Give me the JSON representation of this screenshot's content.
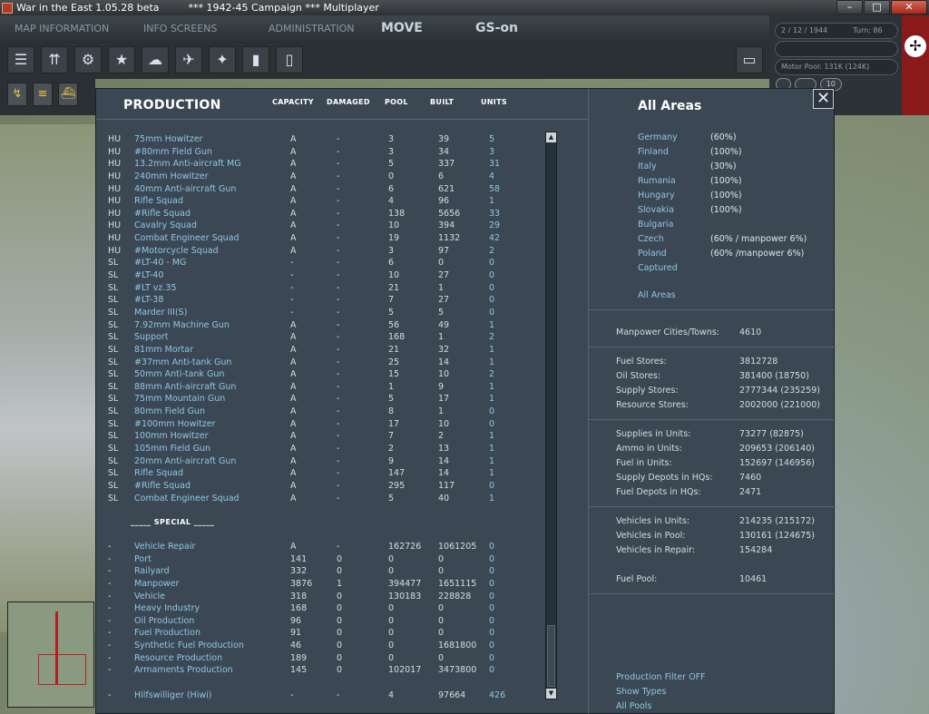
{
  "window": {
    "title": "War in the East 1.05.28 beta",
    "campaign": "***   1942-45 Campaign   ***   Multiplayer"
  },
  "nav": {
    "tabs": [
      "MAP INFORMATION",
      "INFO SCREENS",
      "ADMINISTRATION"
    ],
    "move": "MOVE",
    "gs": "GS-on"
  },
  "status": {
    "date": "2 / 12 / 1944",
    "turn": "Turn: 86",
    "motor_pool": "Motor Pool: 131K (124K)",
    "zoom_value": "10"
  },
  "production": {
    "title": "PRODUCTION",
    "columns": {
      "capacity": "CAPACITY",
      "damaged": "DAMAGED",
      "pool": "POOL",
      "built": "BUILT",
      "units": "UNITS"
    },
    "rows": [
      [
        "HU",
        "75mm Howitzer",
        "A",
        "-",
        "3",
        "39",
        "5"
      ],
      [
        "HU",
        "#80mm Field Gun",
        "A",
        "-",
        "3",
        "34",
        "3"
      ],
      [
        "HU",
        "13.2mm Anti-aircraft MG",
        "A",
        "-",
        "5",
        "337",
        "31"
      ],
      [
        "HU",
        "240mm Howitzer",
        "A",
        "-",
        "0",
        "6",
        "4"
      ],
      [
        "HU",
        "40mm Anti-aircraft Gun",
        "A",
        "-",
        "6",
        "621",
        "58"
      ],
      [
        "HU",
        "Rifle Squad",
        "A",
        "-",
        "4",
        "96",
        "1"
      ],
      [
        "HU",
        "#Rifle Squad",
        "A",
        "-",
        "138",
        "5656",
        "33"
      ],
      [
        "HU",
        "Cavalry Squad",
        "A",
        "-",
        "10",
        "394",
        "29"
      ],
      [
        "HU",
        "Combat Engineer Squad",
        "A",
        "-",
        "19",
        "1132",
        "42"
      ],
      [
        "HU",
        "#Motorcycle Squad",
        "A",
        "-",
        "3",
        "97",
        "2"
      ],
      [
        "SL",
        "#LT-40 - MG",
        "-",
        "-",
        "6",
        "0",
        "0"
      ],
      [
        "SL",
        "#LT-40",
        "-",
        "-",
        "10",
        "27",
        "0"
      ],
      [
        "SL",
        "#LT vz.35",
        "-",
        "-",
        "21",
        "1",
        "0"
      ],
      [
        "SL",
        "#LT-38",
        "-",
        "-",
        "7",
        "27",
        "0"
      ],
      [
        "SL",
        "Marder III(S)",
        "-",
        "-",
        "5",
        "5",
        "0"
      ],
      [
        "SL",
        "7.92mm Machine Gun",
        "A",
        "-",
        "56",
        "49",
        "1"
      ],
      [
        "SL",
        "Support",
        "A",
        "-",
        "168",
        "1",
        "2"
      ],
      [
        "SL",
        "81mm Mortar",
        "A",
        "-",
        "21",
        "32",
        "1"
      ],
      [
        "SL",
        "#37mm Anti-tank Gun",
        "A",
        "-",
        "25",
        "14",
        "1"
      ],
      [
        "SL",
        "50mm Anti-tank Gun",
        "A",
        "-",
        "15",
        "10",
        "2"
      ],
      [
        "SL",
        "88mm Anti-aircraft Gun",
        "A",
        "-",
        "1",
        "9",
        "1"
      ],
      [
        "SL",
        "75mm Mountain Gun",
        "A",
        "-",
        "5",
        "17",
        "1"
      ],
      [
        "SL",
        "80mm Field Gun",
        "A",
        "-",
        "8",
        "1",
        "0"
      ],
      [
        "SL",
        "#100mm Howitzer",
        "A",
        "-",
        "17",
        "10",
        "0"
      ],
      [
        "SL",
        "100mm Howitzer",
        "A",
        "-",
        "7",
        "2",
        "1"
      ],
      [
        "SL",
        "105mm Field Gun",
        "A",
        "-",
        "2",
        "13",
        "1"
      ],
      [
        "SL",
        "20mm Anti-aircraft Gun",
        "A",
        "-",
        "9",
        "14",
        "1"
      ],
      [
        "SL",
        "Rifle Squad",
        "A",
        "-",
        "147",
        "14",
        "1"
      ],
      [
        "SL",
        "#Rifle Squad",
        "A",
        "-",
        "295",
        "117",
        "0"
      ],
      [
        "SL",
        "Combat Engineer Squad",
        "A",
        "-",
        "5",
        "40",
        "1"
      ]
    ],
    "special_label": "_____ SPECIAL _____",
    "special_rows": [
      [
        "-",
        "Vehicle Repair",
        "A",
        "-",
        "162726",
        "1061205",
        "0"
      ],
      [
        "-",
        "Port",
        "141",
        "0",
        "0",
        "0",
        "0"
      ],
      [
        "-",
        "Railyard",
        "332",
        "0",
        "0",
        "0",
        "0"
      ],
      [
        "-",
        "Manpower",
        "3876",
        "1",
        "394477",
        "1651115",
        "0"
      ],
      [
        "-",
        "Vehicle",
        "318",
        "0",
        "130183",
        "228828",
        "0"
      ],
      [
        "-",
        "Heavy Industry",
        "168",
        "0",
        "0",
        "0",
        "0"
      ],
      [
        "-",
        "Oil Production",
        "96",
        "0",
        "0",
        "0",
        "0"
      ],
      [
        "-",
        "Fuel Production",
        "91",
        "0",
        "0",
        "0",
        "0"
      ],
      [
        "-",
        "Synthetic Fuel Production",
        "46",
        "0",
        "0",
        "1681800",
        "0"
      ],
      [
        "-",
        "Resource Production",
        "189",
        "0",
        "0",
        "0",
        "0"
      ],
      [
        "-",
        "Armaments Production",
        "145",
        "0",
        "102017",
        "3473800",
        "0"
      ]
    ],
    "hiwi": [
      "-",
      "Hilfswilliger (Hiwi)",
      "-",
      "-",
      "4",
      "97664",
      "426"
    ]
  },
  "areas": {
    "title": "All Areas",
    "list": [
      {
        "name": "Germany",
        "pct": "(60%)"
      },
      {
        "name": "Finland",
        "pct": "(100%)"
      },
      {
        "name": "Italy",
        "pct": "(30%)"
      },
      {
        "name": "Rumania",
        "pct": "(100%)"
      },
      {
        "name": "Hungary",
        "pct": "(100%)"
      },
      {
        "name": "Slovakia",
        "pct": "(100%)"
      },
      {
        "name": "Bulgaria",
        "pct": ""
      },
      {
        "name": "Czech",
        "pct": "(60% / manpower 6%)"
      },
      {
        "name": "Poland",
        "pct": "(60% /manpower 6%)"
      },
      {
        "name": "Captured",
        "pct": ""
      }
    ],
    "all_link": "All Areas"
  },
  "stats": {
    "manpower": [
      [
        "Manpower Cities/Towns:",
        "4610"
      ]
    ],
    "stores": [
      [
        "Fuel Stores:",
        "3812728"
      ],
      [
        "Oil Stores:",
        "381400 (18750)"
      ],
      [
        "Supply Stores:",
        "2777344 (235259)"
      ],
      [
        "Resource Stores:",
        "2002000 (221000)"
      ]
    ],
    "units": [
      [
        "Supplies in Units:",
        "73277 (82875)"
      ],
      [
        "Ammo in Units:",
        "209653 (206140)"
      ],
      [
        "Fuel in Units:",
        "152697 (146956)"
      ],
      [
        "Supply Depots in HQs:",
        "7460"
      ],
      [
        "Fuel Depots in HQs:",
        "2471"
      ]
    ],
    "vehicles": [
      [
        "Vehicles in Units:",
        "214235 (215172)"
      ],
      [
        "Vehicles in Pool:",
        "130161 (124675)"
      ],
      [
        "Vehicles in Repair:",
        "154284"
      ]
    ],
    "fuel": [
      [
        "Fuel Pool:",
        "10461"
      ]
    ]
  },
  "links": [
    "Production Filter OFF",
    "Show Types",
    "All Pools"
  ]
}
